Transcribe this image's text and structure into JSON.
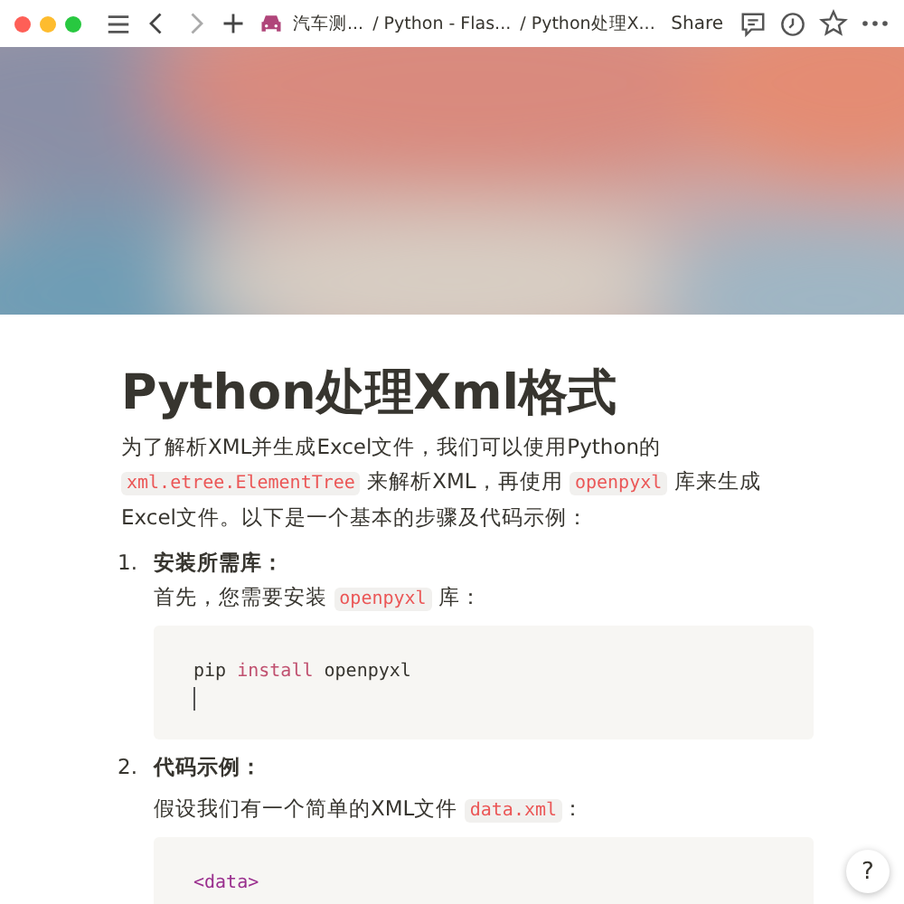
{
  "toolbar": {
    "breadcrumbs": [
      {
        "label": "汽车测..."
      },
      {
        "label": "/ Python - Flas..."
      },
      {
        "label": "/ Python处理X..."
      }
    ],
    "share": "Share"
  },
  "title": "Python处理Xml格式",
  "intro": [
    {
      "kind": "text",
      "text": "为了解析XML并生成Excel文件，我们可以使用Python的 "
    },
    {
      "kind": "code",
      "text": "xml.etree.ElementTree"
    },
    {
      "kind": "text",
      "text": " 来解析XML，再使用 "
    },
    {
      "kind": "code",
      "text": "openpyxl"
    },
    {
      "kind": "text",
      "text": " 库来生成Excel文件。以下是一个基本的步骤及代码示例："
    }
  ],
  "steps": [
    {
      "number": "1.",
      "heading": "安装所需库：",
      "text": [
        {
          "kind": "text",
          "text": "首先，您需要安装 "
        },
        {
          "kind": "code",
          "text": "openpyxl"
        },
        {
          "kind": "text",
          "text": " 库："
        }
      ],
      "code": {
        "cursor": true,
        "tokens": [
          {
            "kind": "plain",
            "text": "pip "
          },
          {
            "kind": "keyword",
            "text": "install"
          },
          {
            "kind": "plain",
            "text": " openpyxl"
          }
        ]
      }
    },
    {
      "number": "2.",
      "heading": "代码示例：",
      "text": [
        {
          "kind": "text",
          "text": "假设我们有一个简单的XML文件 "
        },
        {
          "kind": "code",
          "text": "data.xml"
        },
        {
          "kind": "text",
          "text": "："
        }
      ],
      "code": {
        "tokens": [
          {
            "kind": "tag",
            "text": "<data>"
          }
        ]
      }
    }
  ],
  "help": "?"
}
